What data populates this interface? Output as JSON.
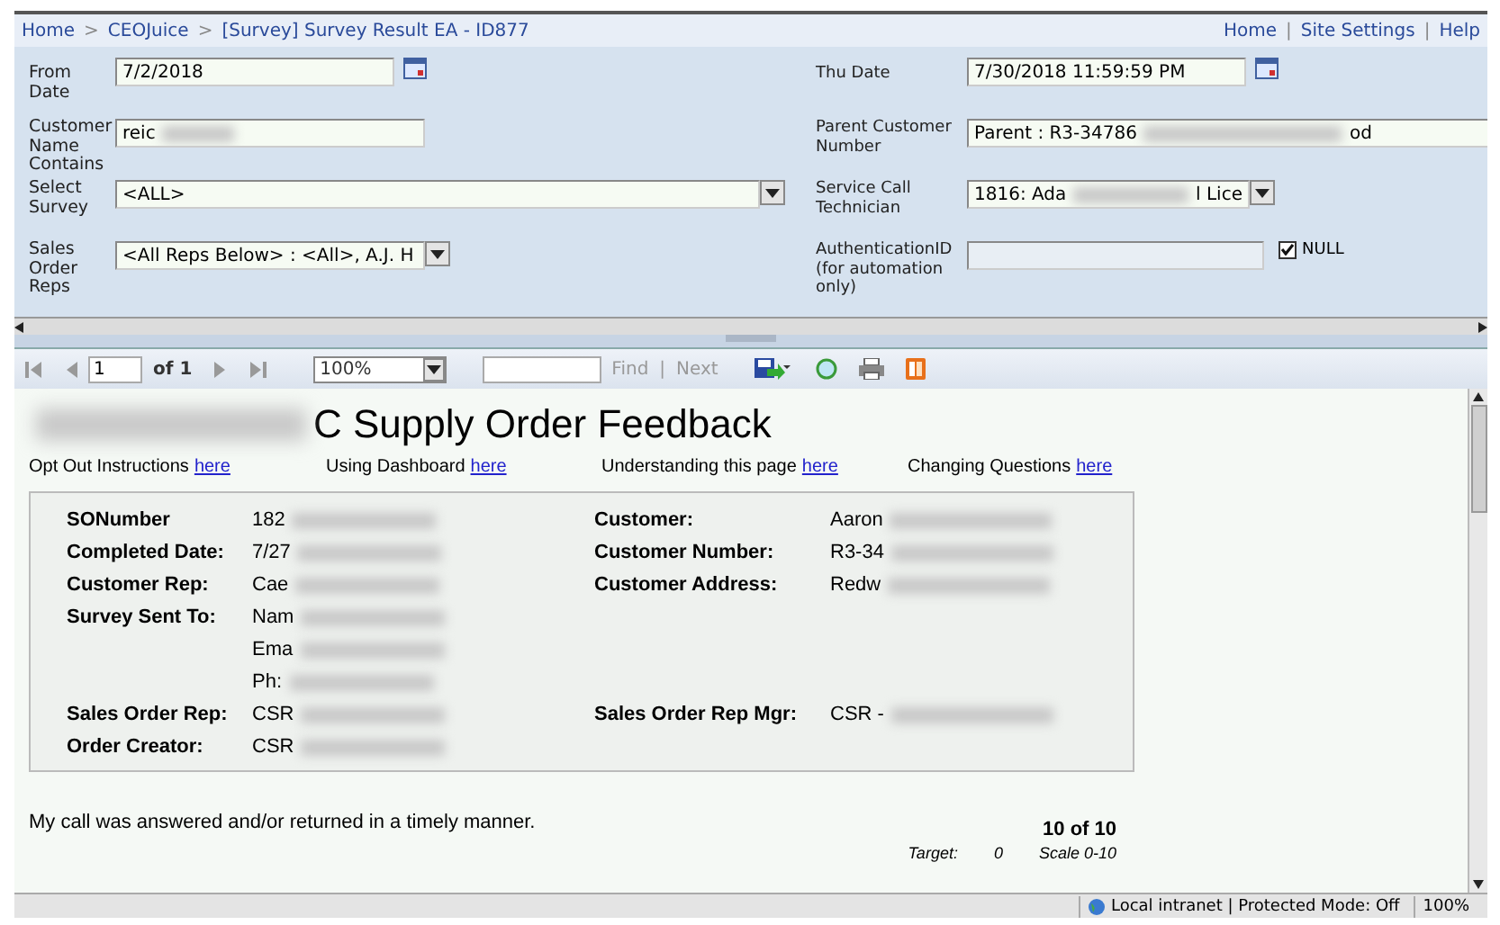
{
  "breadcrumb": {
    "items": [
      "Home",
      "CEOJuice",
      "[Survey] Survey Result EA - ID877"
    ],
    "separator": ">"
  },
  "top_links": {
    "items": [
      "Home",
      "Site Settings",
      "Help"
    ],
    "separator": "|"
  },
  "params": [
    {
      "label": "From Date",
      "kind": "date",
      "value": "7/2/2018"
    },
    {
      "label": "Thu Date",
      "kind": "date",
      "value": "7/30/2018 11:59:59 PM"
    },
    {
      "label": "Customer Name Contains",
      "kind": "text",
      "value": "reic",
      "redacted": true
    },
    {
      "label": "Parent Customer Number",
      "kind": "text",
      "value": "Parent : R3-34786",
      "tail": "od",
      "redacted": true,
      "wide": true
    },
    {
      "label": "Select Survey",
      "kind": "select",
      "value": "<ALL>",
      "wide": true
    },
    {
      "label": "Service Call Technician",
      "kind": "select",
      "value": "1816: Ada",
      "tail": "l Lice",
      "redacted": true
    },
    {
      "label": "Sales Order Reps",
      "kind": "select",
      "value": "<All Reps Below> : <All>, A.J. H"
    },
    {
      "label": "AuthenticationID (for automation only)",
      "kind": "nullable",
      "null_label": "NULL",
      "checked": true
    }
  ],
  "toolbar": {
    "page": "1",
    "of": "of 1",
    "zoom": "100%",
    "find": "Find",
    "separator": "|",
    "next": "Next"
  },
  "report": {
    "title": "C Supply Order Feedback",
    "links": [
      {
        "text": "Opt Out Instructions",
        "link": "here"
      },
      {
        "text": "Using Dashboard",
        "link": "here"
      },
      {
        "text": "Understanding this page",
        "link": "here"
      },
      {
        "text": "Changing Questions",
        "link": "here"
      }
    ],
    "details": [
      {
        "label": "SONumber",
        "value": "182",
        "label2": "Customer:",
        "value2": "Aaron"
      },
      {
        "label": "Completed Date:",
        "value": "7/27",
        "label2": "Customer Number:",
        "value2": "R3-34"
      },
      {
        "label": "Customer Rep:",
        "value": "Cae",
        "label2": "Customer Address:",
        "value2": "Redw"
      },
      {
        "label": "Survey Sent To:",
        "value": "Nam"
      },
      {
        "value": "Ema"
      },
      {
        "value": "Ph:"
      },
      {
        "label": "Sales Order Rep:",
        "value": "CSR",
        "label2": "Sales Order Rep Mgr:",
        "value2": "CSR -"
      },
      {
        "label": "Order Creator:",
        "value": "CSR"
      }
    ],
    "question": "My call was answered and/or returned in a timely manner.",
    "score": "10 of 10",
    "target_label": "Target:",
    "target": "0",
    "scale": "Scale 0-10"
  },
  "status_bar": {
    "zone": "Local intranet | Protected Mode: Off",
    "zoom": "100%"
  }
}
